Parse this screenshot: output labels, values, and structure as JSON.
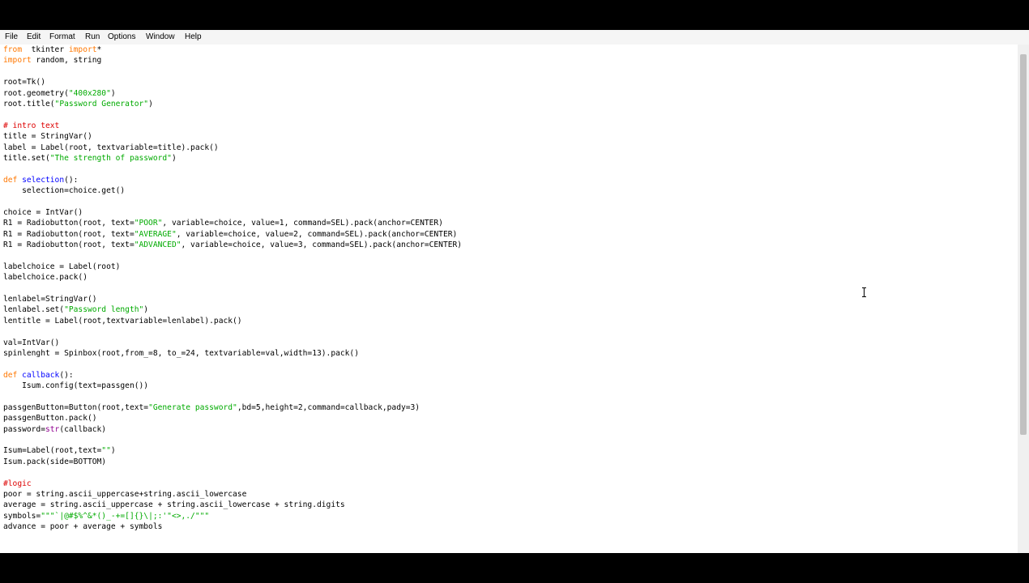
{
  "menu": {
    "items": [
      "File",
      "Edit",
      "Format",
      "Run",
      "Options",
      "Window",
      "Help"
    ]
  },
  "editor": {
    "lines": [
      "from  tkinter import*",
      "import random, string",
      "",
      "root=Tk()",
      "root.geometry(\"400x280\")",
      "root.title(\"Password Generator\")",
      "",
      "# intro text",
      "title = StringVar()",
      "label = Label(root, textvariable=title).pack()",
      "title.set(\"The strength of password\")",
      "",
      "def selection():",
      "    selection=choice.get()",
      "",
      "choice = IntVar()",
      "R1 = Radiobutton(root, text=\"POOR\", variable=choice, value=1, command=SEL).pack(anchor=CENTER)",
      "R1 = Radiobutton(root, text=\"AVERAGE\", variable=choice, value=2, command=SEL).pack(anchor=CENTER)",
      "R1 = Radiobutton(root, text=\"ADVANCED\", variable=choice, value=3, command=SEL).pack(anchor=CENTER)",
      "",
      "labelchoice = Label(root)",
      "labelchoice.pack()",
      "",
      "lenlabel=StringVar()",
      "lenlabel.set(\"Password length\")",
      "lentitle = Label(root,textvariable=lenlabel).pack()",
      "",
      "val=IntVar()",
      "spinlenght = Spinbox(root,from_=8, to_=24, textvariable=val,width=13).pack()",
      "",
      "def callback():",
      "    Isum.config(text=passgen())",
      "",
      "passgenButton=Button(root,text=\"Generate password\",bd=5,height=2,command=callback,pady=3)",
      "passgenButton.pack()",
      "password=str(callback)",
      "",
      "Isum=Label(root,text=\"\")",
      "Isum.pack(side=BOTTOM)",
      "",
      "#logic",
      "poor = string.ascii_uppercase+string.ascii_lowercase",
      "average = string.ascii_uppercase + string.ascii_lowercase + string.digits",
      "symbols=\"\"\"`|@#$%^&*()_-+=[]{}\\|;:'\"<>,./\"\"\"",
      "advance = poor + average + symbols"
    ]
  }
}
